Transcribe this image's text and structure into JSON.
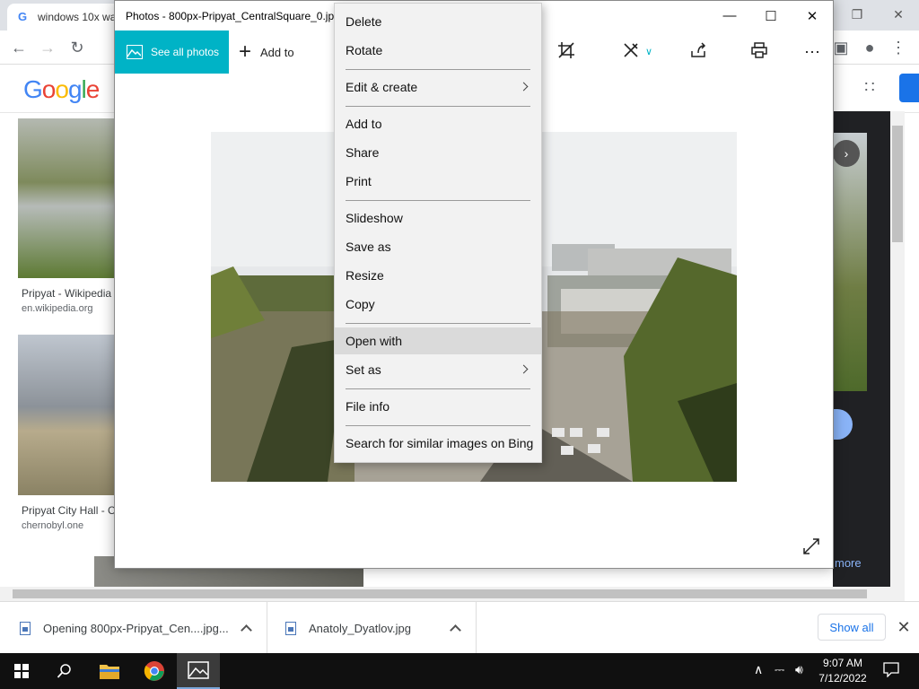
{
  "chrome": {
    "tab_title": "windows 10x wa",
    "google_logo": "Google",
    "results": [
      {
        "title": "Pripyat - Wikipedia",
        "source": "en.wikipedia.org"
      },
      {
        "title": "Pripyat City Hall - C",
        "source": "chernobyl.one"
      }
    ],
    "side_more": "more"
  },
  "photos": {
    "title": "Photos - 800px-Pripyat_CentralSquare_0.jpg",
    "see_all": "See all photos",
    "add_to": "Add to",
    "accent": "#00b3c6"
  },
  "context_menu": {
    "items": [
      {
        "label": "Delete"
      },
      {
        "label": "Rotate"
      },
      {
        "label": "Edit & create",
        "submenu": true
      },
      {
        "label": "Add to"
      },
      {
        "label": "Share"
      },
      {
        "label": "Print"
      },
      {
        "label": "Slideshow"
      },
      {
        "label": "Save as"
      },
      {
        "label": "Resize"
      },
      {
        "label": "Copy"
      },
      {
        "label": "Open with",
        "highlighted": true
      },
      {
        "label": "Set as",
        "submenu": true
      },
      {
        "label": "File info"
      },
      {
        "label": "Search for similar images on Bing"
      }
    ]
  },
  "downloads": {
    "items": [
      {
        "label": "Opening 800px-Pripyat_Cen....jpg..."
      },
      {
        "label": "Anatoly_Dyatlov.jpg"
      }
    ],
    "show_all": "Show all"
  },
  "taskbar": {
    "time": "9:07 AM",
    "date": "7/12/2022"
  }
}
